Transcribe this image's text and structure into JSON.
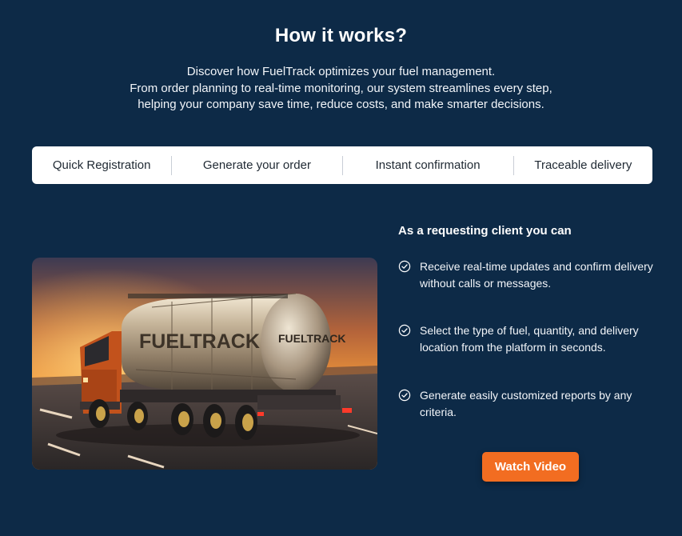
{
  "section": {
    "title": "How it works?",
    "description": [
      "Discover how FuelTrack optimizes your fuel management.",
      "From order planning to real-time monitoring, our system streamlines every step,",
      "helping your company save time, reduce costs, and make smarter decisions."
    ]
  },
  "tabs": [
    "Quick Registration",
    "Generate your order",
    "Instant confirmation",
    "Traceable delivery"
  ],
  "image": {
    "tank_brand": "FUELTRACK",
    "tank_brand_rear": "FUELTRACK"
  },
  "client": {
    "heading": "As a requesting client you can",
    "benefits": [
      "Receive real-time updates and confirm delivery without calls or messages.",
      "Select the type of fuel, quantity, and delivery location from the platform in seconds.",
      "Generate easily customized reports by any criteria."
    ],
    "benefit_icon": "check-circle-icon"
  },
  "cta": {
    "label": "Watch Video"
  },
  "colors": {
    "background": "#0d2a47",
    "accent": "#f26d21",
    "tab_bar": "#ffffff"
  }
}
